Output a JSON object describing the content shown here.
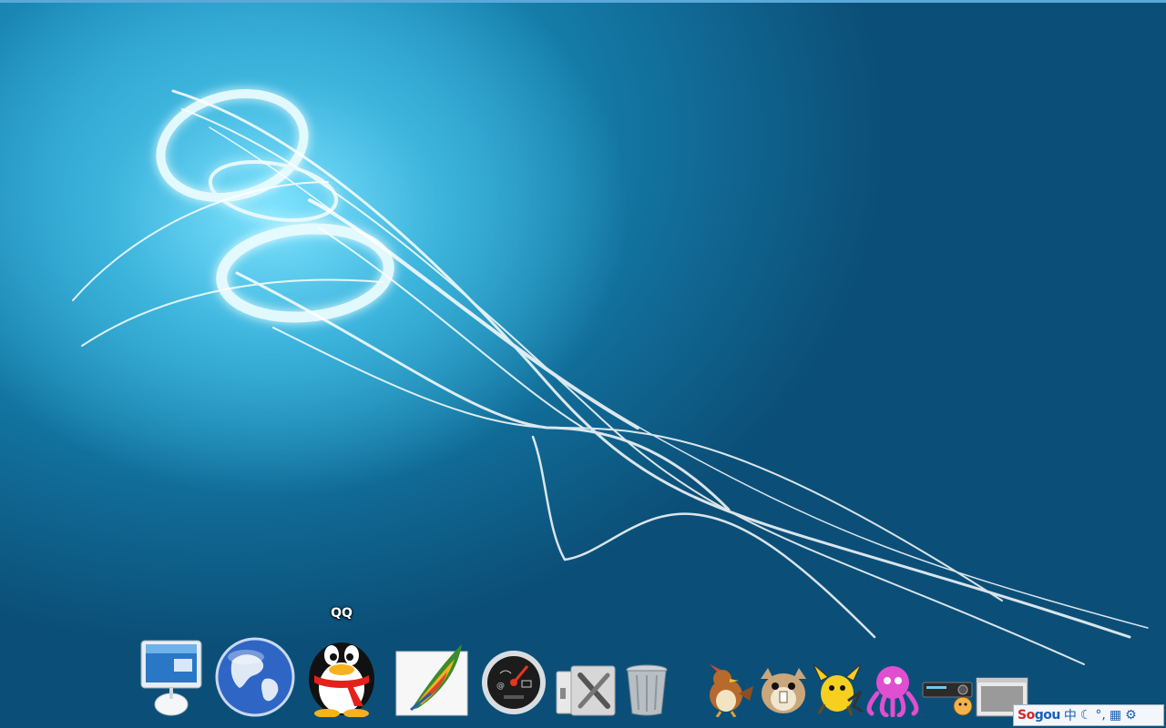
{
  "desktop": {
    "wallpaper": "blue-light-streaks",
    "accent_color": "#35b9e6"
  },
  "dock": {
    "tooltip": "QQ",
    "items": [
      {
        "name": "finder-imac-icon"
      },
      {
        "name": "internet-globe-icon"
      },
      {
        "name": "qq-penguin-icon"
      },
      {
        "name": "feather-writer-icon"
      },
      {
        "name": "dashboard-gauge-icon"
      },
      {
        "name": "system-tools-icon"
      },
      {
        "name": "trash-icon"
      },
      {
        "name": "pidgeotto-icon"
      },
      {
        "name": "raticate-icon"
      },
      {
        "name": "raichu-icon"
      },
      {
        "name": "pink-octopus-icon"
      },
      {
        "name": "media-player-icon"
      },
      {
        "name": "window-thumbnail-icon"
      }
    ]
  },
  "ime": {
    "logo_part1": "So",
    "logo_part2": "gou",
    "mode": "中",
    "symbols": [
      "moon-icon",
      "°,",
      "keyboard-icon",
      "tools-icon"
    ]
  }
}
